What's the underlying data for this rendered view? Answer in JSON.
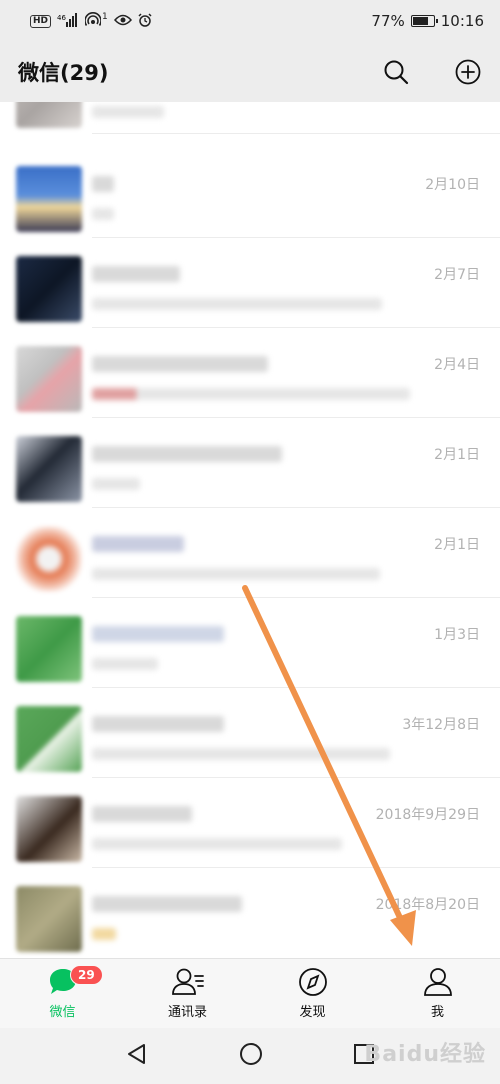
{
  "status_bar": {
    "network": "46",
    "notif_count": "1",
    "battery_text": "77%",
    "battery_level": 0.77,
    "time": "10:16"
  },
  "header": {
    "title": "微信(29)",
    "search_icon": "search-icon",
    "add_icon": "plus-circle-icon"
  },
  "chats": [
    {
      "time": ""
    },
    {
      "time": "2月10日"
    },
    {
      "time": "2月7日"
    },
    {
      "time": "2月4日"
    },
    {
      "time": "2月1日"
    },
    {
      "time": "2月1日"
    },
    {
      "time": "1月3日"
    },
    {
      "time": "3年12月8日"
    },
    {
      "time": "2018年9月29日"
    },
    {
      "time": "2018年8月20日"
    }
  ],
  "tabs": [
    {
      "label": "微信",
      "icon": "chat-bubble-icon",
      "badge": "29",
      "active": true
    },
    {
      "label": "通讯录",
      "icon": "contacts-icon"
    },
    {
      "label": "发现",
      "icon": "compass-icon"
    },
    {
      "label": "我",
      "icon": "user-icon"
    }
  ],
  "colors": {
    "accent": "#07c160",
    "badge": "#fa5151",
    "arrow": "#f0924a"
  },
  "watermark": "Baidu经验"
}
